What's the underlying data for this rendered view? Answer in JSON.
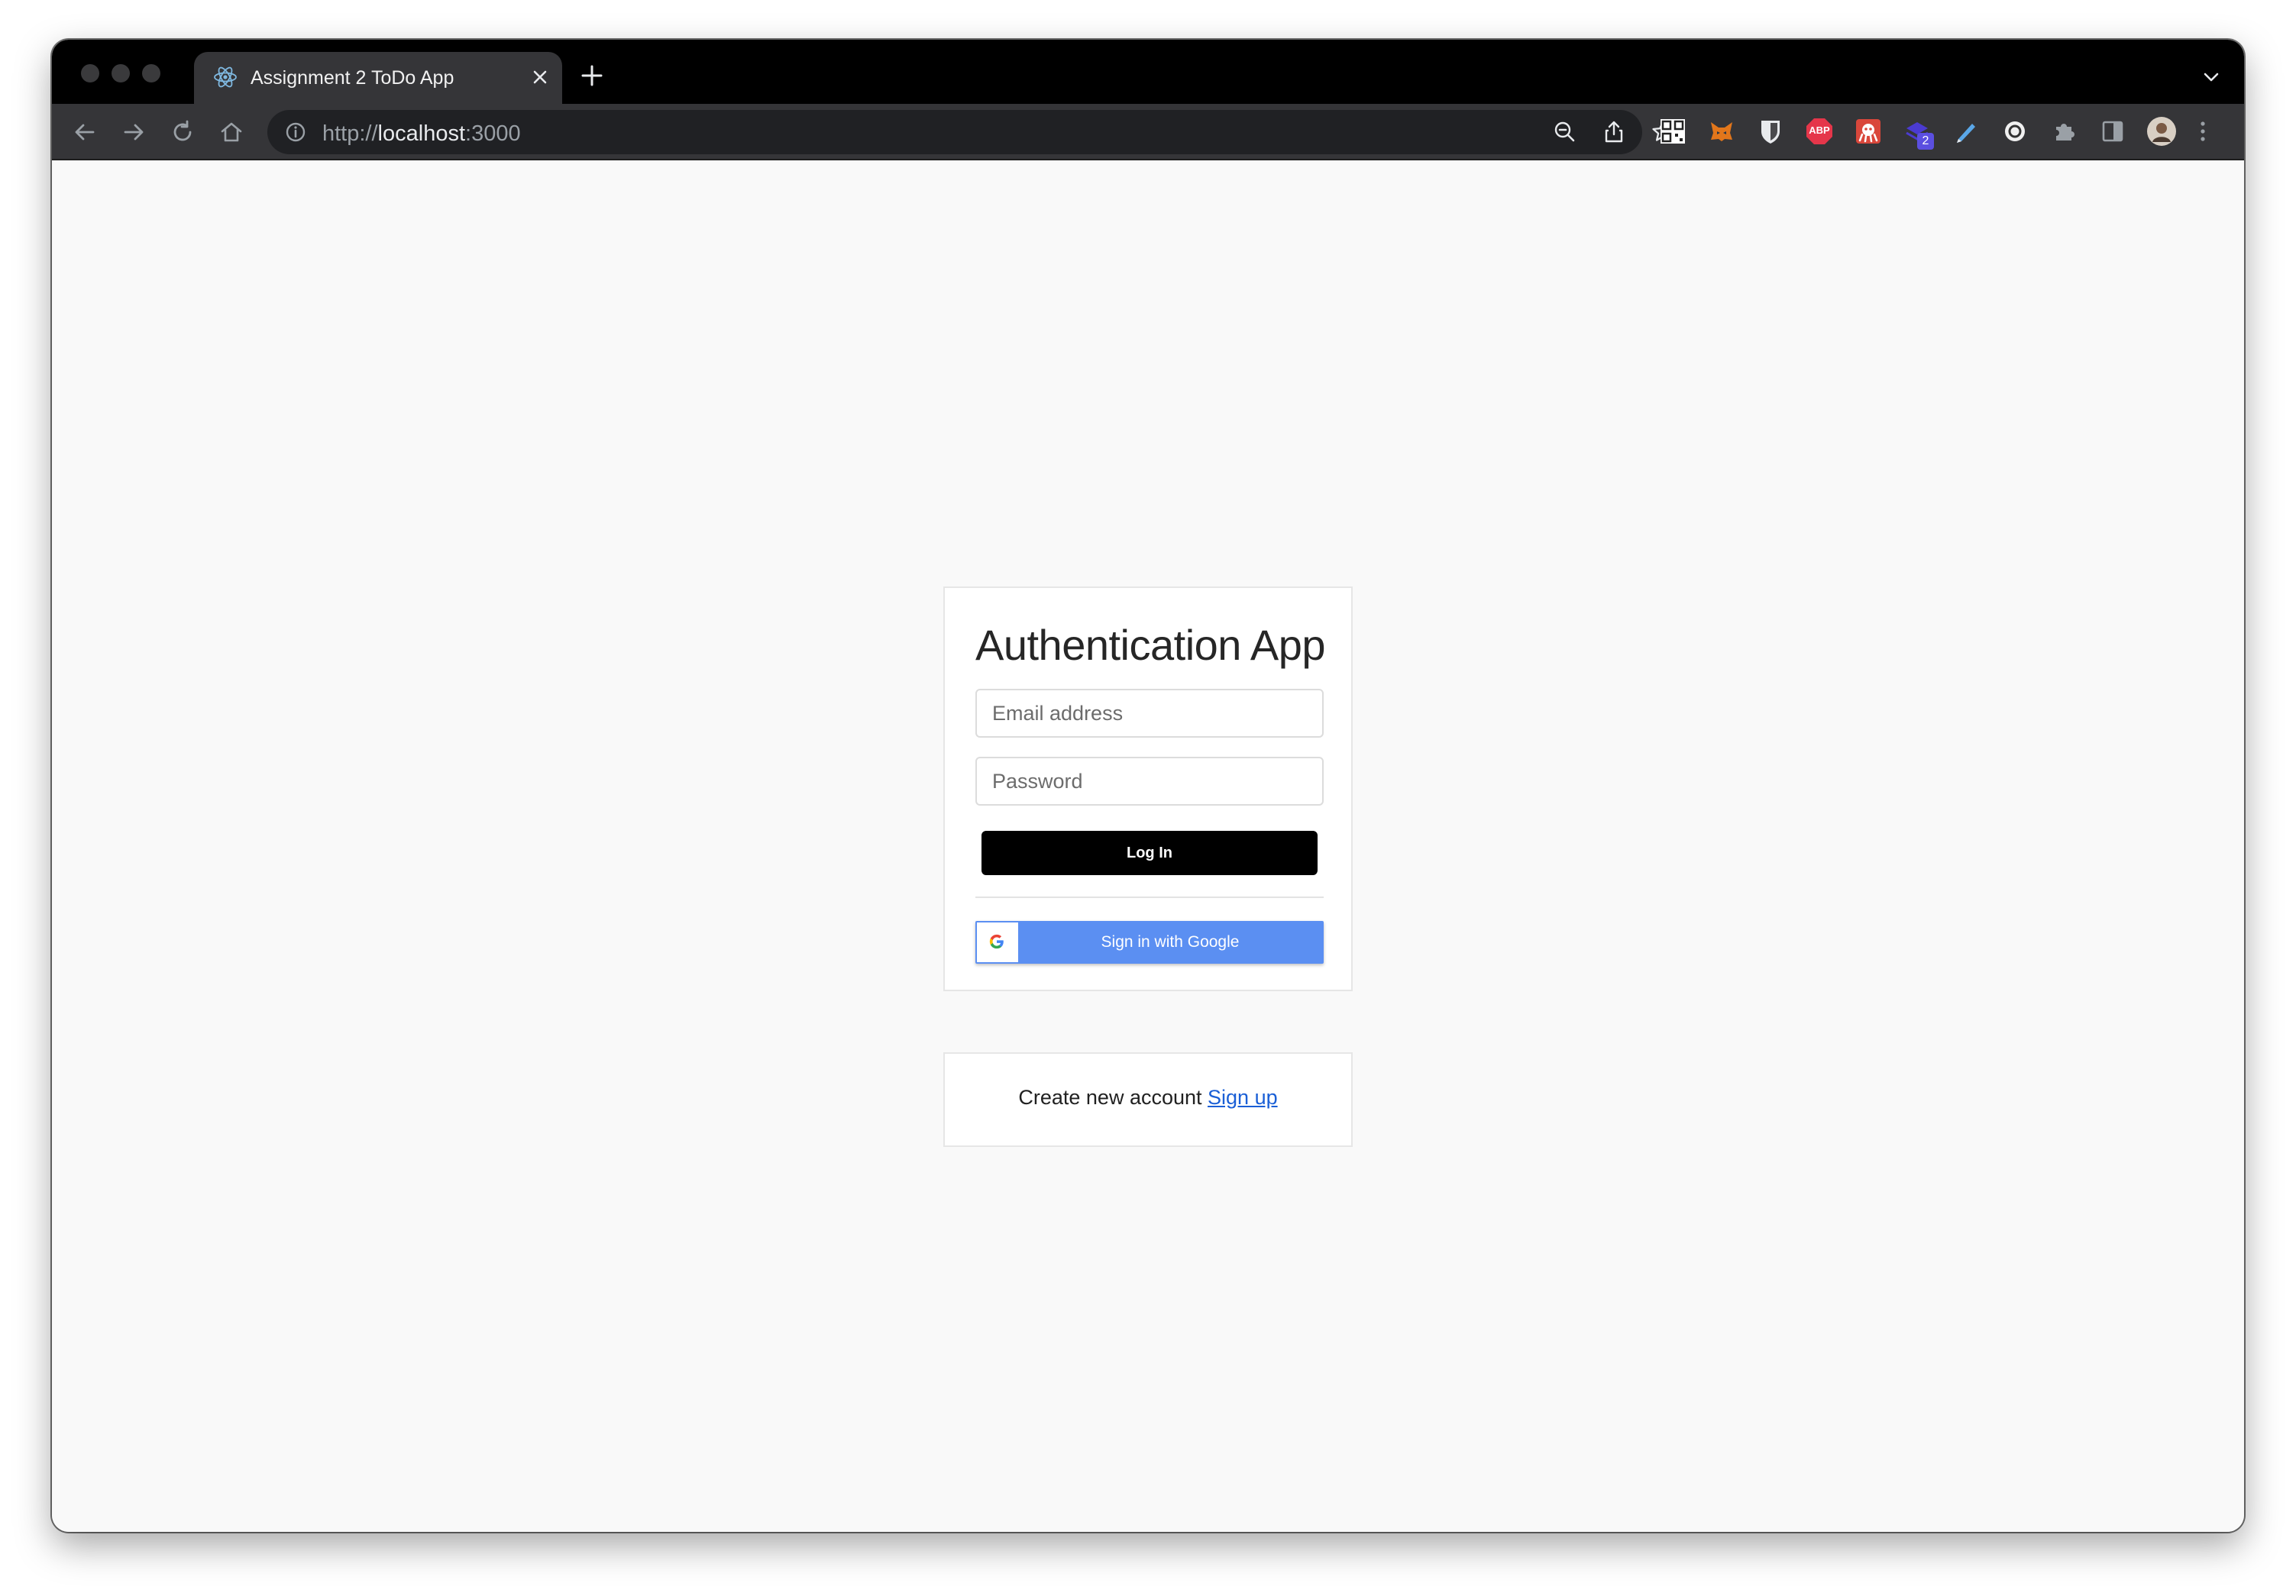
{
  "browser": {
    "tab_title": "Assignment 2 ToDo App",
    "url_scheme": "http://",
    "url_host": "localhost",
    "url_port": ":3000",
    "extension_badge": "2",
    "abp_label": "ABP"
  },
  "auth": {
    "title": "Authentication App",
    "email_placeholder": "Email address",
    "password_placeholder": "Password",
    "login_label": "Log In",
    "google_label": "Sign in with Google"
  },
  "signup": {
    "prompt": "Create new account",
    "link_label": "Sign up"
  },
  "colors": {
    "login_button": "#000000",
    "google_button": "#5b8ff2",
    "link": "#1a5fd6",
    "page_background": "#f9f9f9"
  }
}
